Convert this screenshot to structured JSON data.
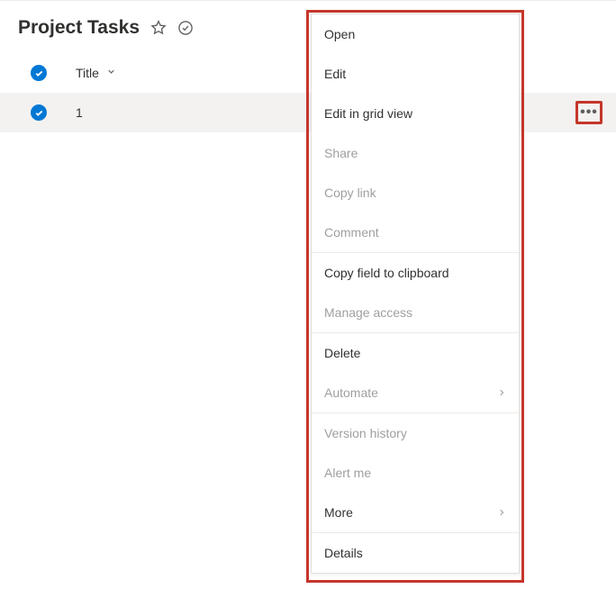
{
  "header": {
    "title": "Project Tasks"
  },
  "columns": {
    "title": "Title"
  },
  "rows": [
    {
      "title": "1"
    }
  ],
  "menu": {
    "open": "Open",
    "edit": "Edit",
    "edit_grid": "Edit in grid view",
    "share": "Share",
    "copy_link": "Copy link",
    "comment": "Comment",
    "copy_field": "Copy field to clipboard",
    "manage_access": "Manage access",
    "delete": "Delete",
    "automate": "Automate",
    "version_history": "Version history",
    "alert_me": "Alert me",
    "more": "More",
    "details": "Details"
  }
}
